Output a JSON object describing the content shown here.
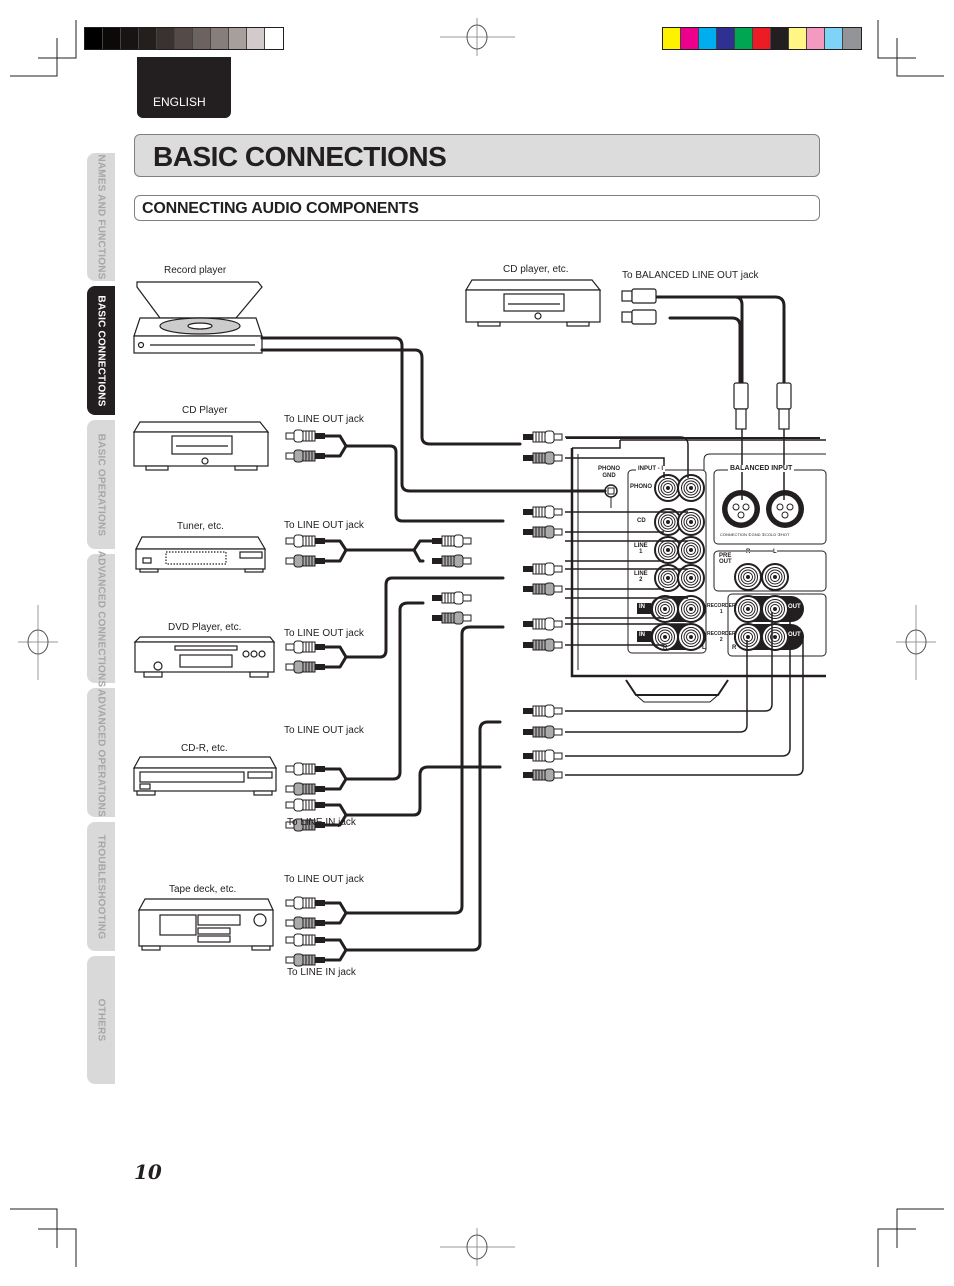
{
  "print_marks": {
    "grayscale_bar": [
      "#000000",
      "#0b0a09",
      "#171413",
      "#231f1c",
      "#3a3230",
      "#544a47",
      "#6c625e",
      "#877d79",
      "#a89f9c",
      "#d3cbcb",
      "#ffffff"
    ],
    "color_bar": [
      "#fff200",
      "#ec008c",
      "#00aeef",
      "#2e3192",
      "#00a651",
      "#ed1c24",
      "#231f20",
      "#fff685",
      "#f49ac1",
      "#7fd3f7",
      "#929497"
    ]
  },
  "language_tab": "ENGLISH",
  "side_tabs": [
    {
      "label": "NAMES AND FUNCTIONS",
      "active": false
    },
    {
      "label": "BASIC CONNECTIONS",
      "active": true
    },
    {
      "label": "BASIC OPERATIONS",
      "active": false
    },
    {
      "label": "ADVANCED CONNECTIONS",
      "active": false
    },
    {
      "label": "ADVANCED OPERATIONS",
      "active": false
    },
    {
      "label": "TROUBLESHOOTING",
      "active": false
    },
    {
      "label": "OTHERS",
      "active": false
    }
  ],
  "page_title": "BASIC CONNECTIONS",
  "section_title": "CONNECTING AUDIO COMPONENTS",
  "devices": {
    "record_player": "Record player",
    "cd_player": "CD Player",
    "cd_player_balanced": "CD player, etc.",
    "tuner": "Tuner, etc.",
    "dvd_player": "DVD Player, etc.",
    "cd_r": "CD-R, etc.",
    "tape_deck": "Tape deck, etc."
  },
  "jack_labels": {
    "line_out": "To LINE OUT jack",
    "line_in": "To LINE IN jack",
    "balanced_line_out": "To BALANCED LINE OUT jack"
  },
  "amp_panel": {
    "phono_gnd": [
      "PHONO",
      "GND"
    ],
    "input_group": "INPUT - I",
    "phono": "PHONO",
    "cd": "CD",
    "line1": [
      "LINE",
      "1"
    ],
    "line2": [
      "LINE",
      "2"
    ],
    "balanced_input": "BALANCED INPUT",
    "balanced_r": "R",
    "balanced_l": "L",
    "balanced_pins": "CONNECTION ①GND ②COLD ③HOT",
    "pre_out": [
      "PRE",
      "OUT"
    ],
    "pre_r": "R",
    "pre_l": "L",
    "recorder1": [
      "RECORDER",
      "1"
    ],
    "recorder2": [
      "RECORDER",
      "2"
    ],
    "in": "IN",
    "out": "OUT",
    "r": "R",
    "l": "L"
  },
  "page_number": "10"
}
